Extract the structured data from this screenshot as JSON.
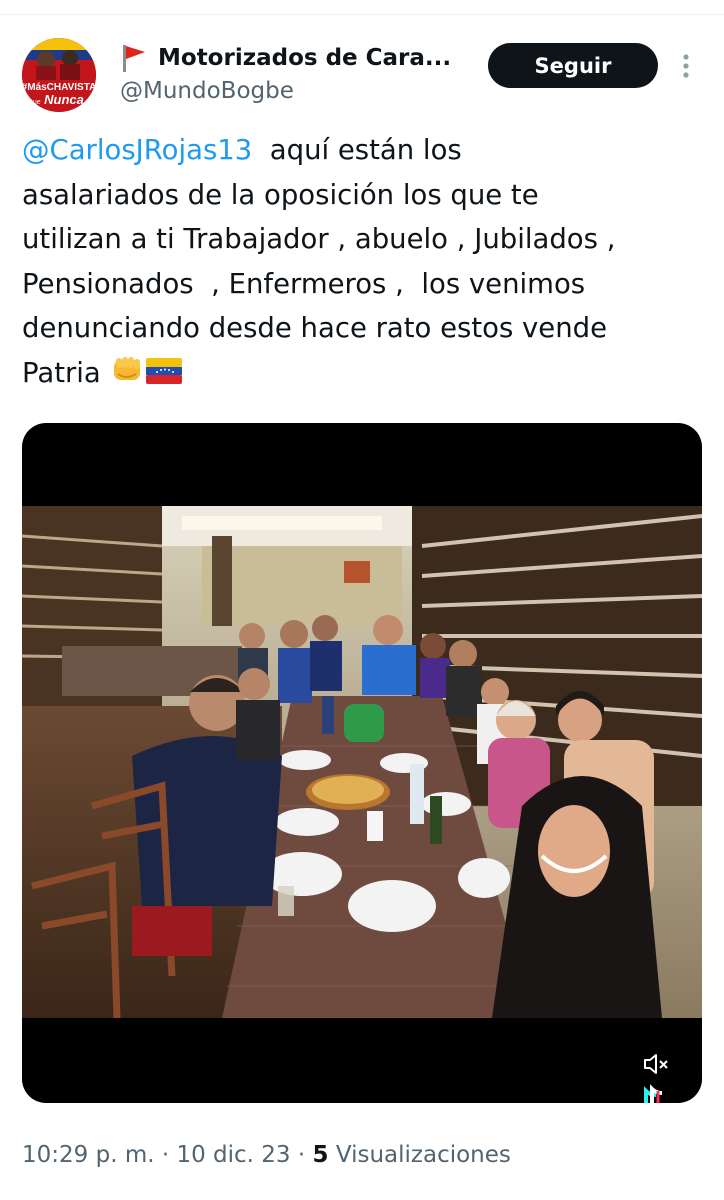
{
  "author": {
    "display_name": "Motorizados de Cara...",
    "handle": "@MundoBogbe",
    "avatar_text_top": "#MásCHAVISTA",
    "avatar_text_left": "Que",
    "avatar_text_main": "Nunca"
  },
  "actions": {
    "follow_label": "Seguir"
  },
  "tweet": {
    "mention": "@CarlosJRojas13",
    "body": "  aquí están los\nasalariados de la oposición los que te\nutilizan a ti Trabajador , abuelo , Jubilados ,\nPensionados  , Enfermeros ,  los venimos\ndenunciando desde hace rato estos vende\nPatria ",
    "emojis": [
      "oncoming-fist-icon",
      "venezuela-flag-icon"
    ]
  },
  "media": {
    "type": "video",
    "muted": true,
    "watermark": "tiktok-logo-icon"
  },
  "meta": {
    "time": "10:29 p. m.",
    "separator": "·",
    "date": "10 dic. 23",
    "views_count": "5",
    "views_label": "Visualizaciones"
  },
  "colors": {
    "mention": "#1d9bf0",
    "follow_bg": "#0f1419",
    "secondary_text": "#536471"
  }
}
